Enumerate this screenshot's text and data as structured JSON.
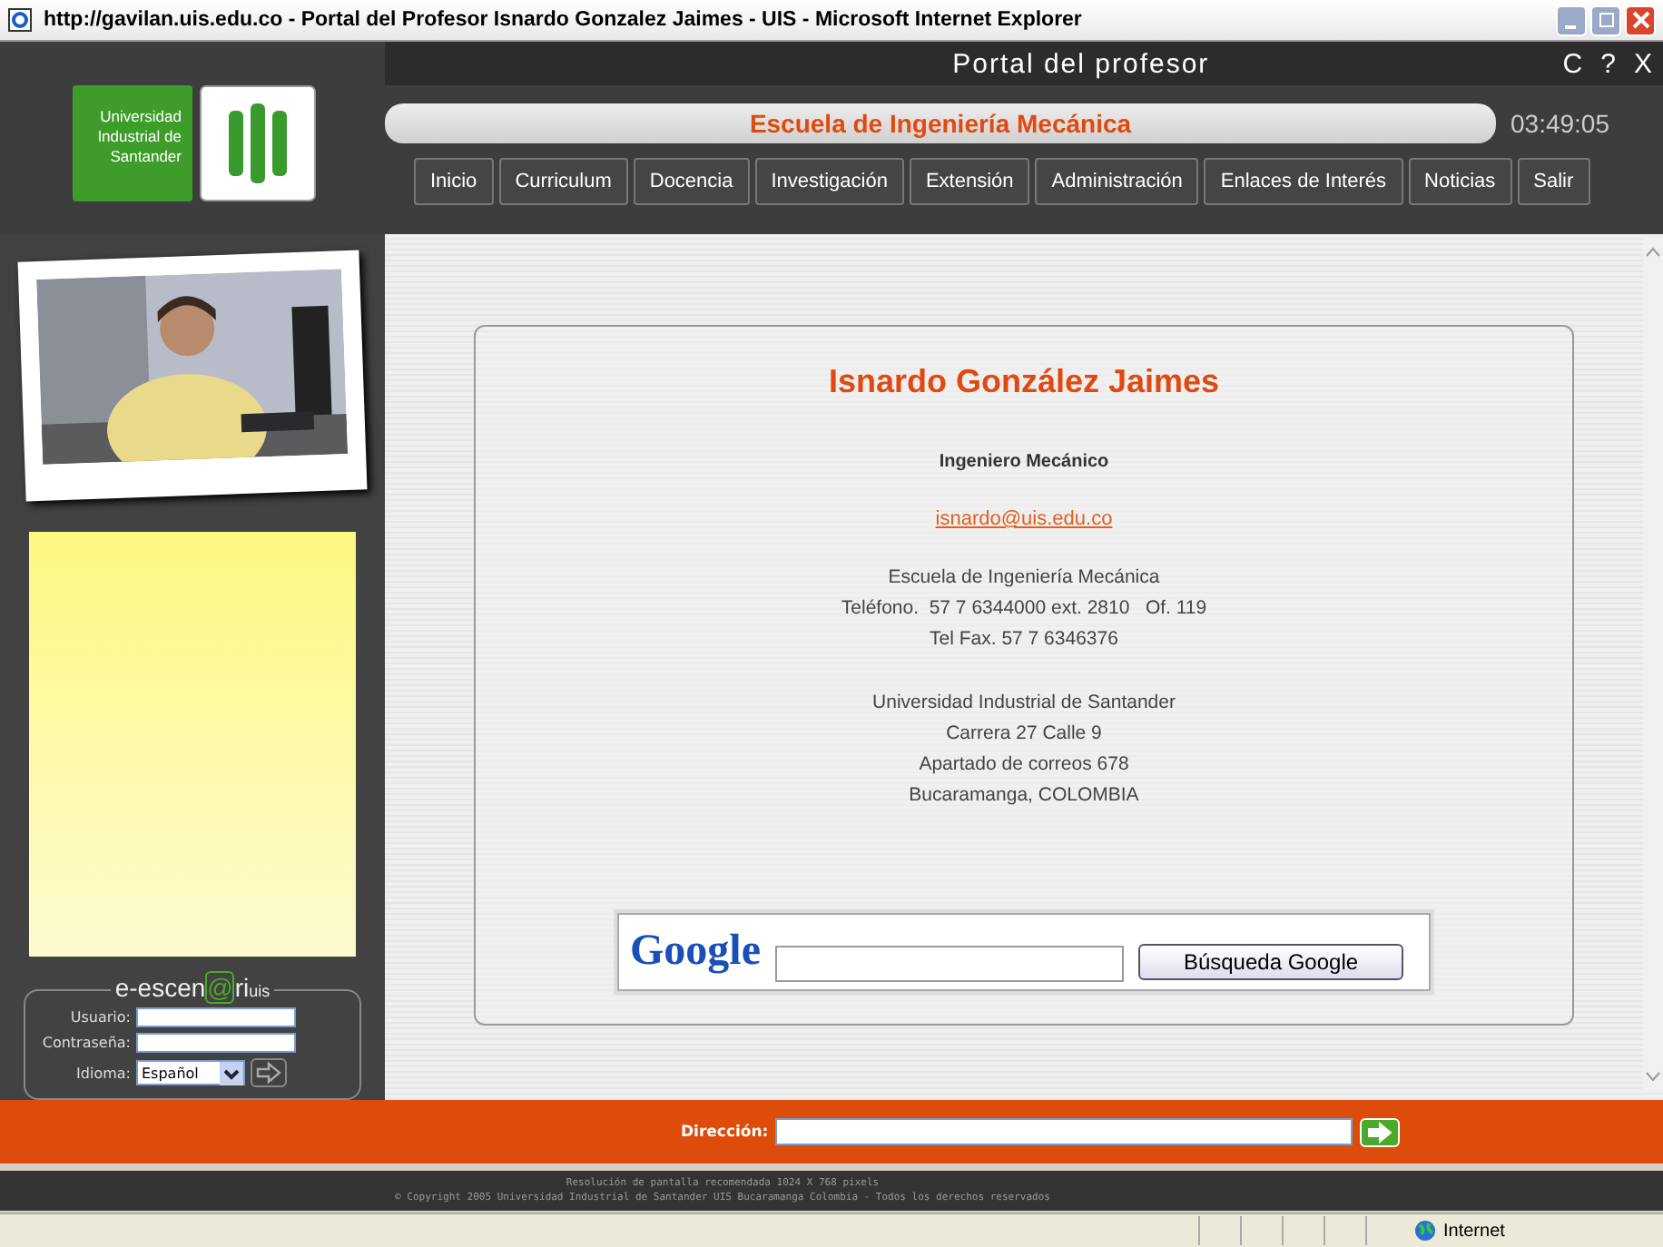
{
  "window": {
    "title": "http://gavilan.uis.edu.co - Portal del Profesor Isnardo Gonzalez Jaimes - UIS - Microsoft Internet Explorer"
  },
  "header": {
    "portal_title": "Portal del profesor",
    "controls": [
      "C",
      "?",
      "X"
    ],
    "university": "Universidad Industrial de Santander",
    "school": "Escuela de Ingeniería Mecánica",
    "time": "03:49:05"
  },
  "nav": [
    "Inicio",
    "Curriculum",
    "Docencia",
    "Investigación",
    "Extensión",
    "Administración",
    "Enlaces de Interés",
    "Noticias",
    "Salir"
  ],
  "sidebar": {
    "login": {
      "logo": {
        "prefix": "e-escen",
        "at": "@",
        "suffix": "ri",
        "sub": "uis"
      },
      "user_label": "Usuario:",
      "password_label": "Contraseña:",
      "language_label": "Idioma:",
      "language": "Español"
    }
  },
  "profile": {
    "name": "Isnardo González Jaimes",
    "title": "Ingeniero Mecánico",
    "email": "isnardo@uis.edu.co",
    "blocks": [
      [
        "Escuela de Ingeniería Mecánica",
        "Teléfono.  57 7 6344000 ext. 2810   Of. 119",
        "Tel Fax. 57 7 6346376"
      ],
      [
        "Universidad Industrial de Santander",
        "Carrera 27 Calle 9",
        "Apartado de correos 678",
        "Bucaramanga, COLOMBIA"
      ]
    ]
  },
  "search": {
    "logo": "Google",
    "button": "Búsqueda Google"
  },
  "address_bar": {
    "label": "Dirección:"
  },
  "footer": {
    "lines": [
      "Resolución de pantalla recomendada 1024 X 768 pixels",
      "Copyright 2005 Universidad Industrial de Santander UIS Bucaramanga Colombia - Todos los derechos reservados"
    ],
    "copyright_mark": "©"
  },
  "status_bar": {
    "zone": "Internet"
  }
}
